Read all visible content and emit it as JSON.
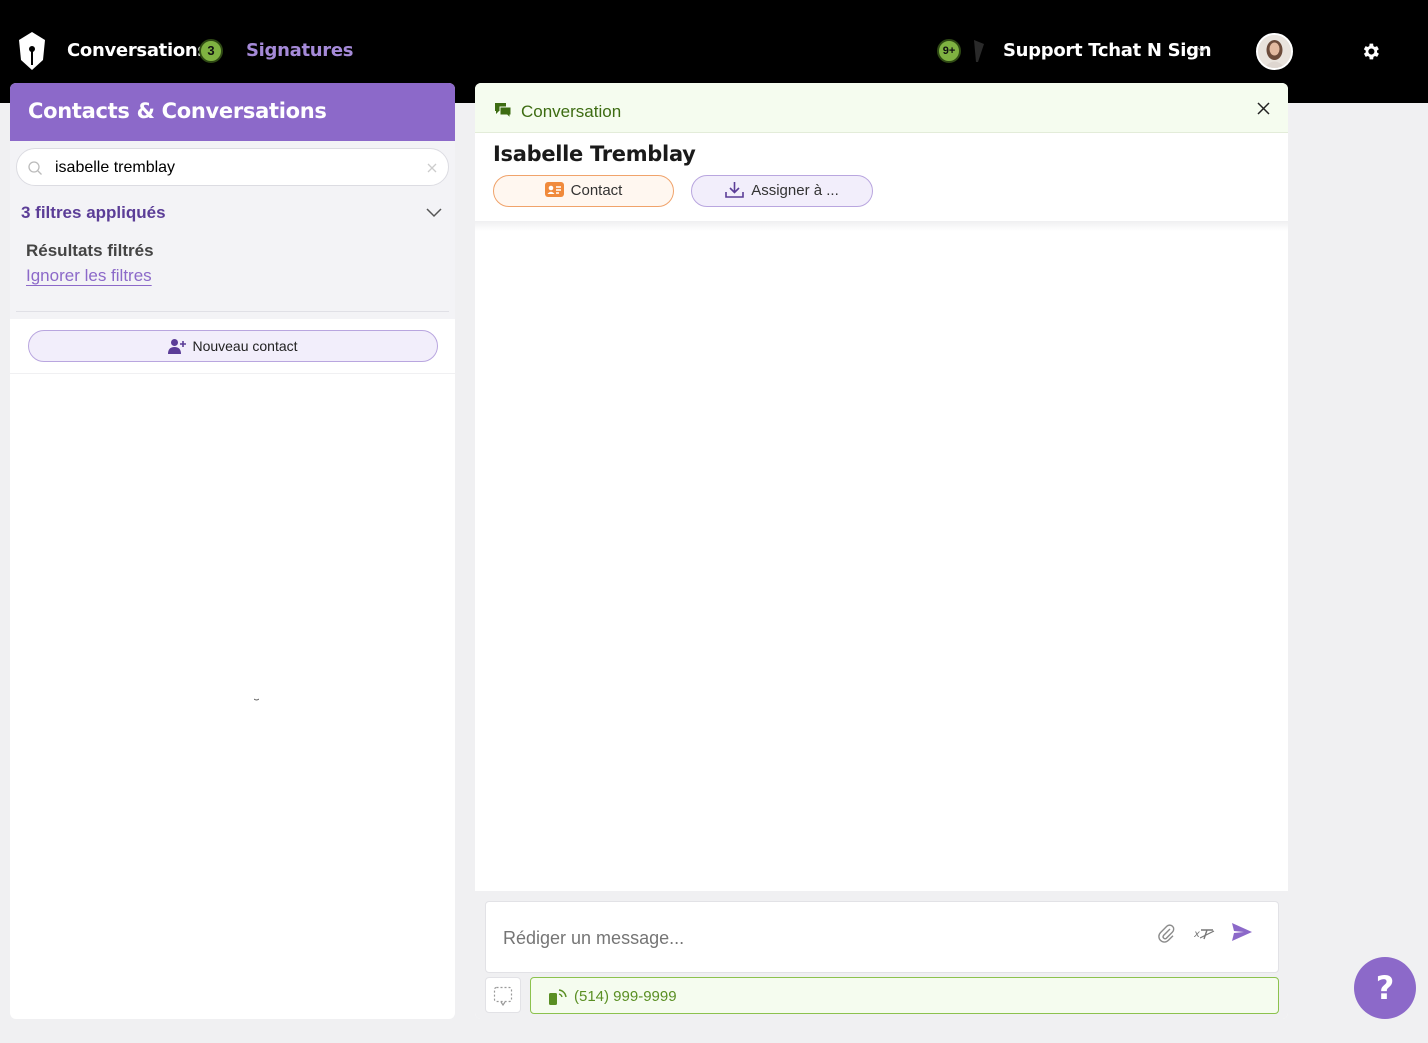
{
  "topbar": {
    "nav_conversations": "Conversations",
    "nav_conversations_count": "3",
    "nav_signatures": "Signatures",
    "notifications_badge": "9+",
    "account_name": "Support Tchat N Sign"
  },
  "left_panel": {
    "title": "Contacts & Conversations",
    "search_value": "isabelle tremblay",
    "filters_label": "3 filtres appliqués",
    "results_label": "Résultats filtrés",
    "ignore_filters": "Ignorer les filtres",
    "new_contact": "Nouveau contact"
  },
  "conversation": {
    "header_title": "Conversation",
    "contact_name": "Isabelle Tremblay",
    "contact_button": "Contact",
    "assign_button": "Assigner à ...",
    "message_placeholder": "Rédiger un message...",
    "phone": "(514) 999-9999"
  },
  "help": {
    "label": "?"
  },
  "colors": {
    "accent_purple": "#8c69c9",
    "dark_purple": "#5b3d97",
    "green_badge": "#7fb241",
    "green_text": "#3d6c12",
    "orange": "#f0a36b"
  }
}
